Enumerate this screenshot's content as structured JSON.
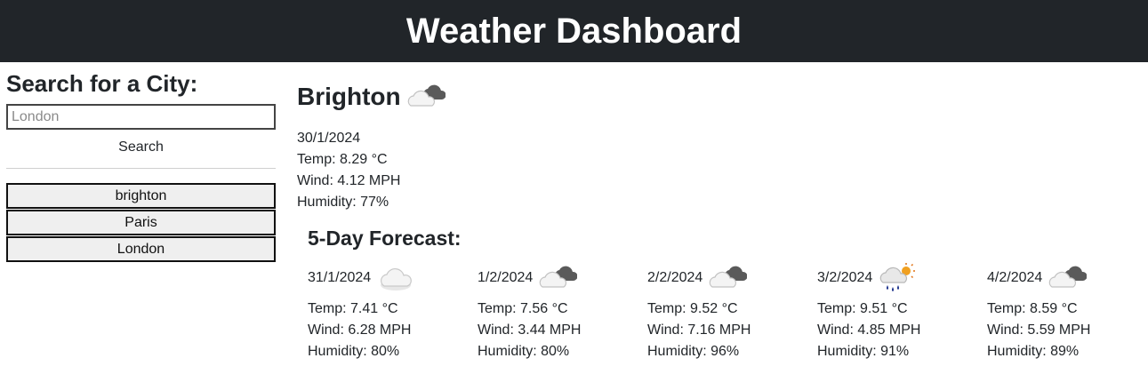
{
  "header": {
    "title": "Weather Dashboard"
  },
  "sidebar": {
    "heading": "Search for a City:",
    "search_placeholder": "London",
    "search_label": "Search",
    "history": [
      "brighton",
      "Paris",
      "London"
    ]
  },
  "current": {
    "city": "Brighton",
    "icon": "cloudy-icon",
    "date": "30/1/2024",
    "temp": "Temp: 8.29 °C",
    "wind": "Wind: 4.12 MPH",
    "humidity": "Humidity: 77%"
  },
  "forecast": {
    "title": "5-Day Forecast:",
    "days": [
      {
        "date": "31/1/2024",
        "icon": "cloud-icon",
        "temp": "Temp: 7.41 °C",
        "wind": "Wind: 6.28 MPH",
        "humidity": "Humidity: 80%"
      },
      {
        "date": "1/2/2024",
        "icon": "cloudy-icon",
        "temp": "Temp: 7.56 °C",
        "wind": "Wind: 3.44 MPH",
        "humidity": "Humidity: 80%"
      },
      {
        "date": "2/2/2024",
        "icon": "cloudy-icon",
        "temp": "Temp: 9.52 °C",
        "wind": "Wind: 7.16 MPH",
        "humidity": "Humidity: 96%"
      },
      {
        "date": "3/2/2024",
        "icon": "rain-sun-icon",
        "temp": "Temp: 9.51 °C",
        "wind": "Wind: 4.85 MPH",
        "humidity": "Humidity: 91%"
      },
      {
        "date": "4/2/2024",
        "icon": "cloudy-icon",
        "temp": "Temp: 8.59 °C",
        "wind": "Wind: 5.59 MPH",
        "humidity": "Humidity: 89%"
      }
    ]
  },
  "colors": {
    "header_bg": "#212529",
    "header_text": "#ffffff"
  }
}
